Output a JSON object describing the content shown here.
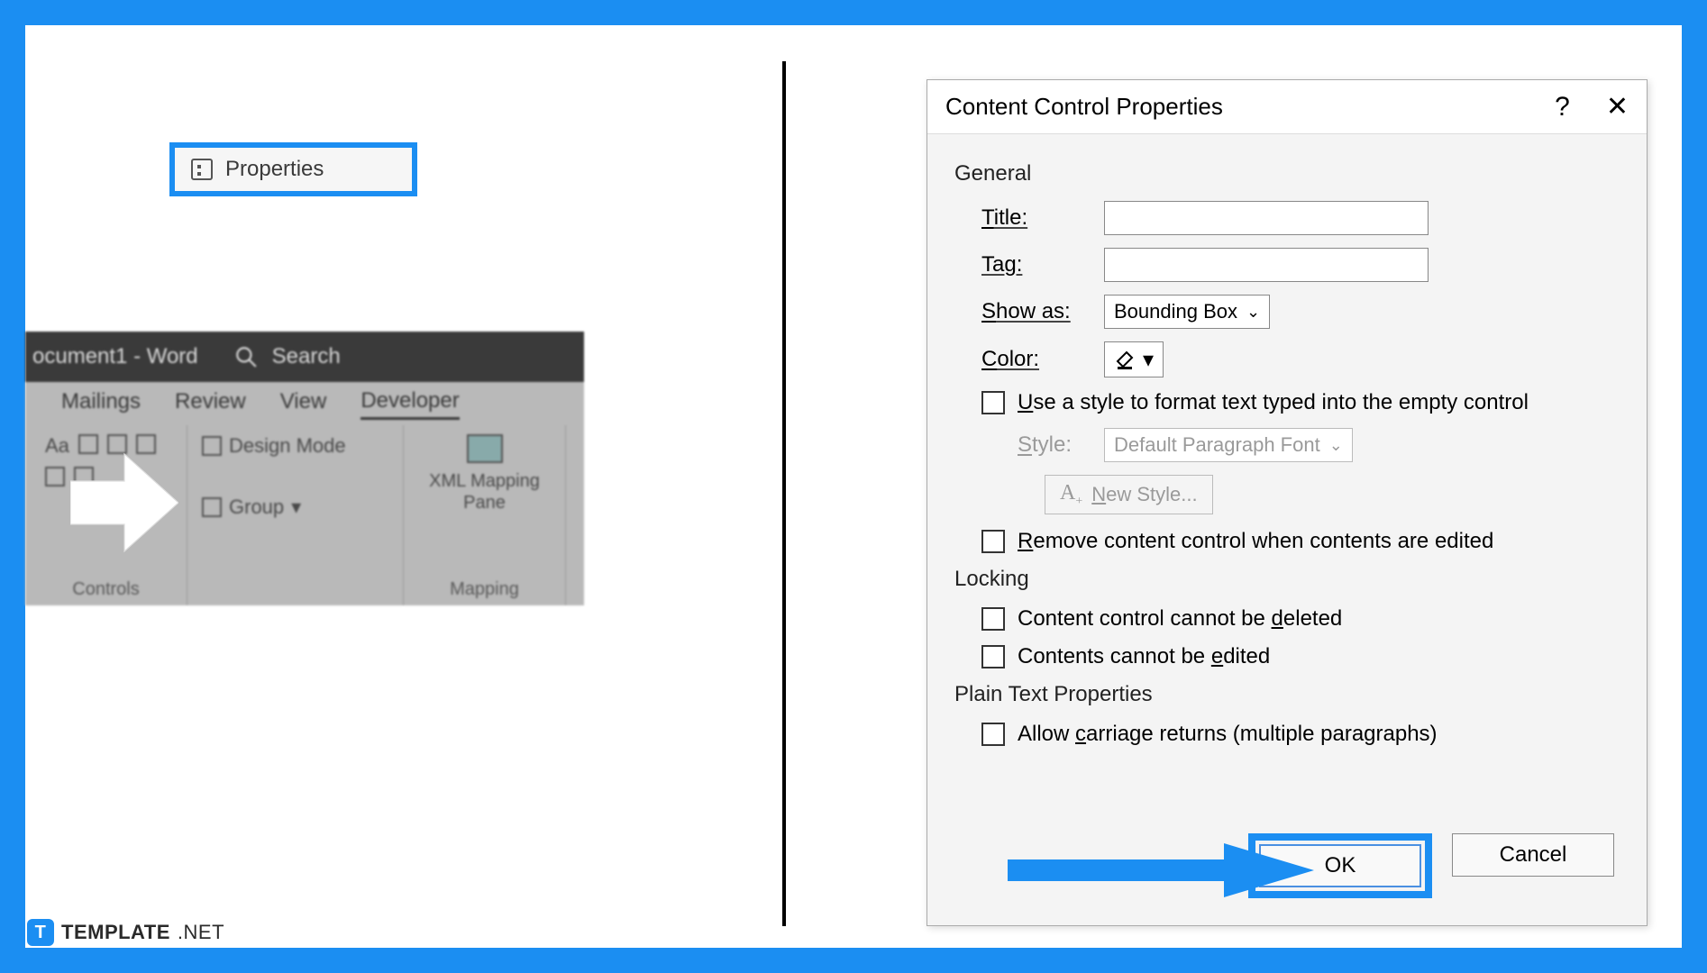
{
  "left": {
    "title_doc": "ocument1 - Word",
    "search_placeholder": "Search",
    "tabs": [
      "Mailings",
      "Review",
      "View",
      "Developer"
    ],
    "active_tab": "Developer",
    "controls": {
      "design_mode": "Design Mode",
      "properties": "Properties",
      "group": "Group",
      "controls_label": "Controls"
    },
    "mapping": {
      "xml_mapping": "XML Mapping Pane",
      "mapping_label": "Mapping"
    }
  },
  "dialog": {
    "title": "Content Control Properties",
    "general_label": "General",
    "title_label": "Title:",
    "title_value": "",
    "tag_label": "Tag:",
    "tag_value": "",
    "show_as_label": "Show as:",
    "show_as_value": "Bounding Box",
    "color_label": "Color:",
    "use_style_label": "Use a style to format text typed into the empty control",
    "style_label": "Style:",
    "style_value": "Default Paragraph Font",
    "new_style_label": "New Style...",
    "remove_label": "Remove content control when contents are edited",
    "locking_label": "Locking",
    "cannot_delete": "Content control cannot be deleted",
    "cannot_edit": "Contents cannot be edited",
    "plaintext_label": "Plain Text Properties",
    "carriage_returns": "Allow carriage returns (multiple paragraphs)",
    "ok": "OK",
    "cancel": "Cancel"
  },
  "watermark": {
    "brand": "TEMPLATE",
    "suffix": ".NET"
  },
  "Aa": "Aa"
}
